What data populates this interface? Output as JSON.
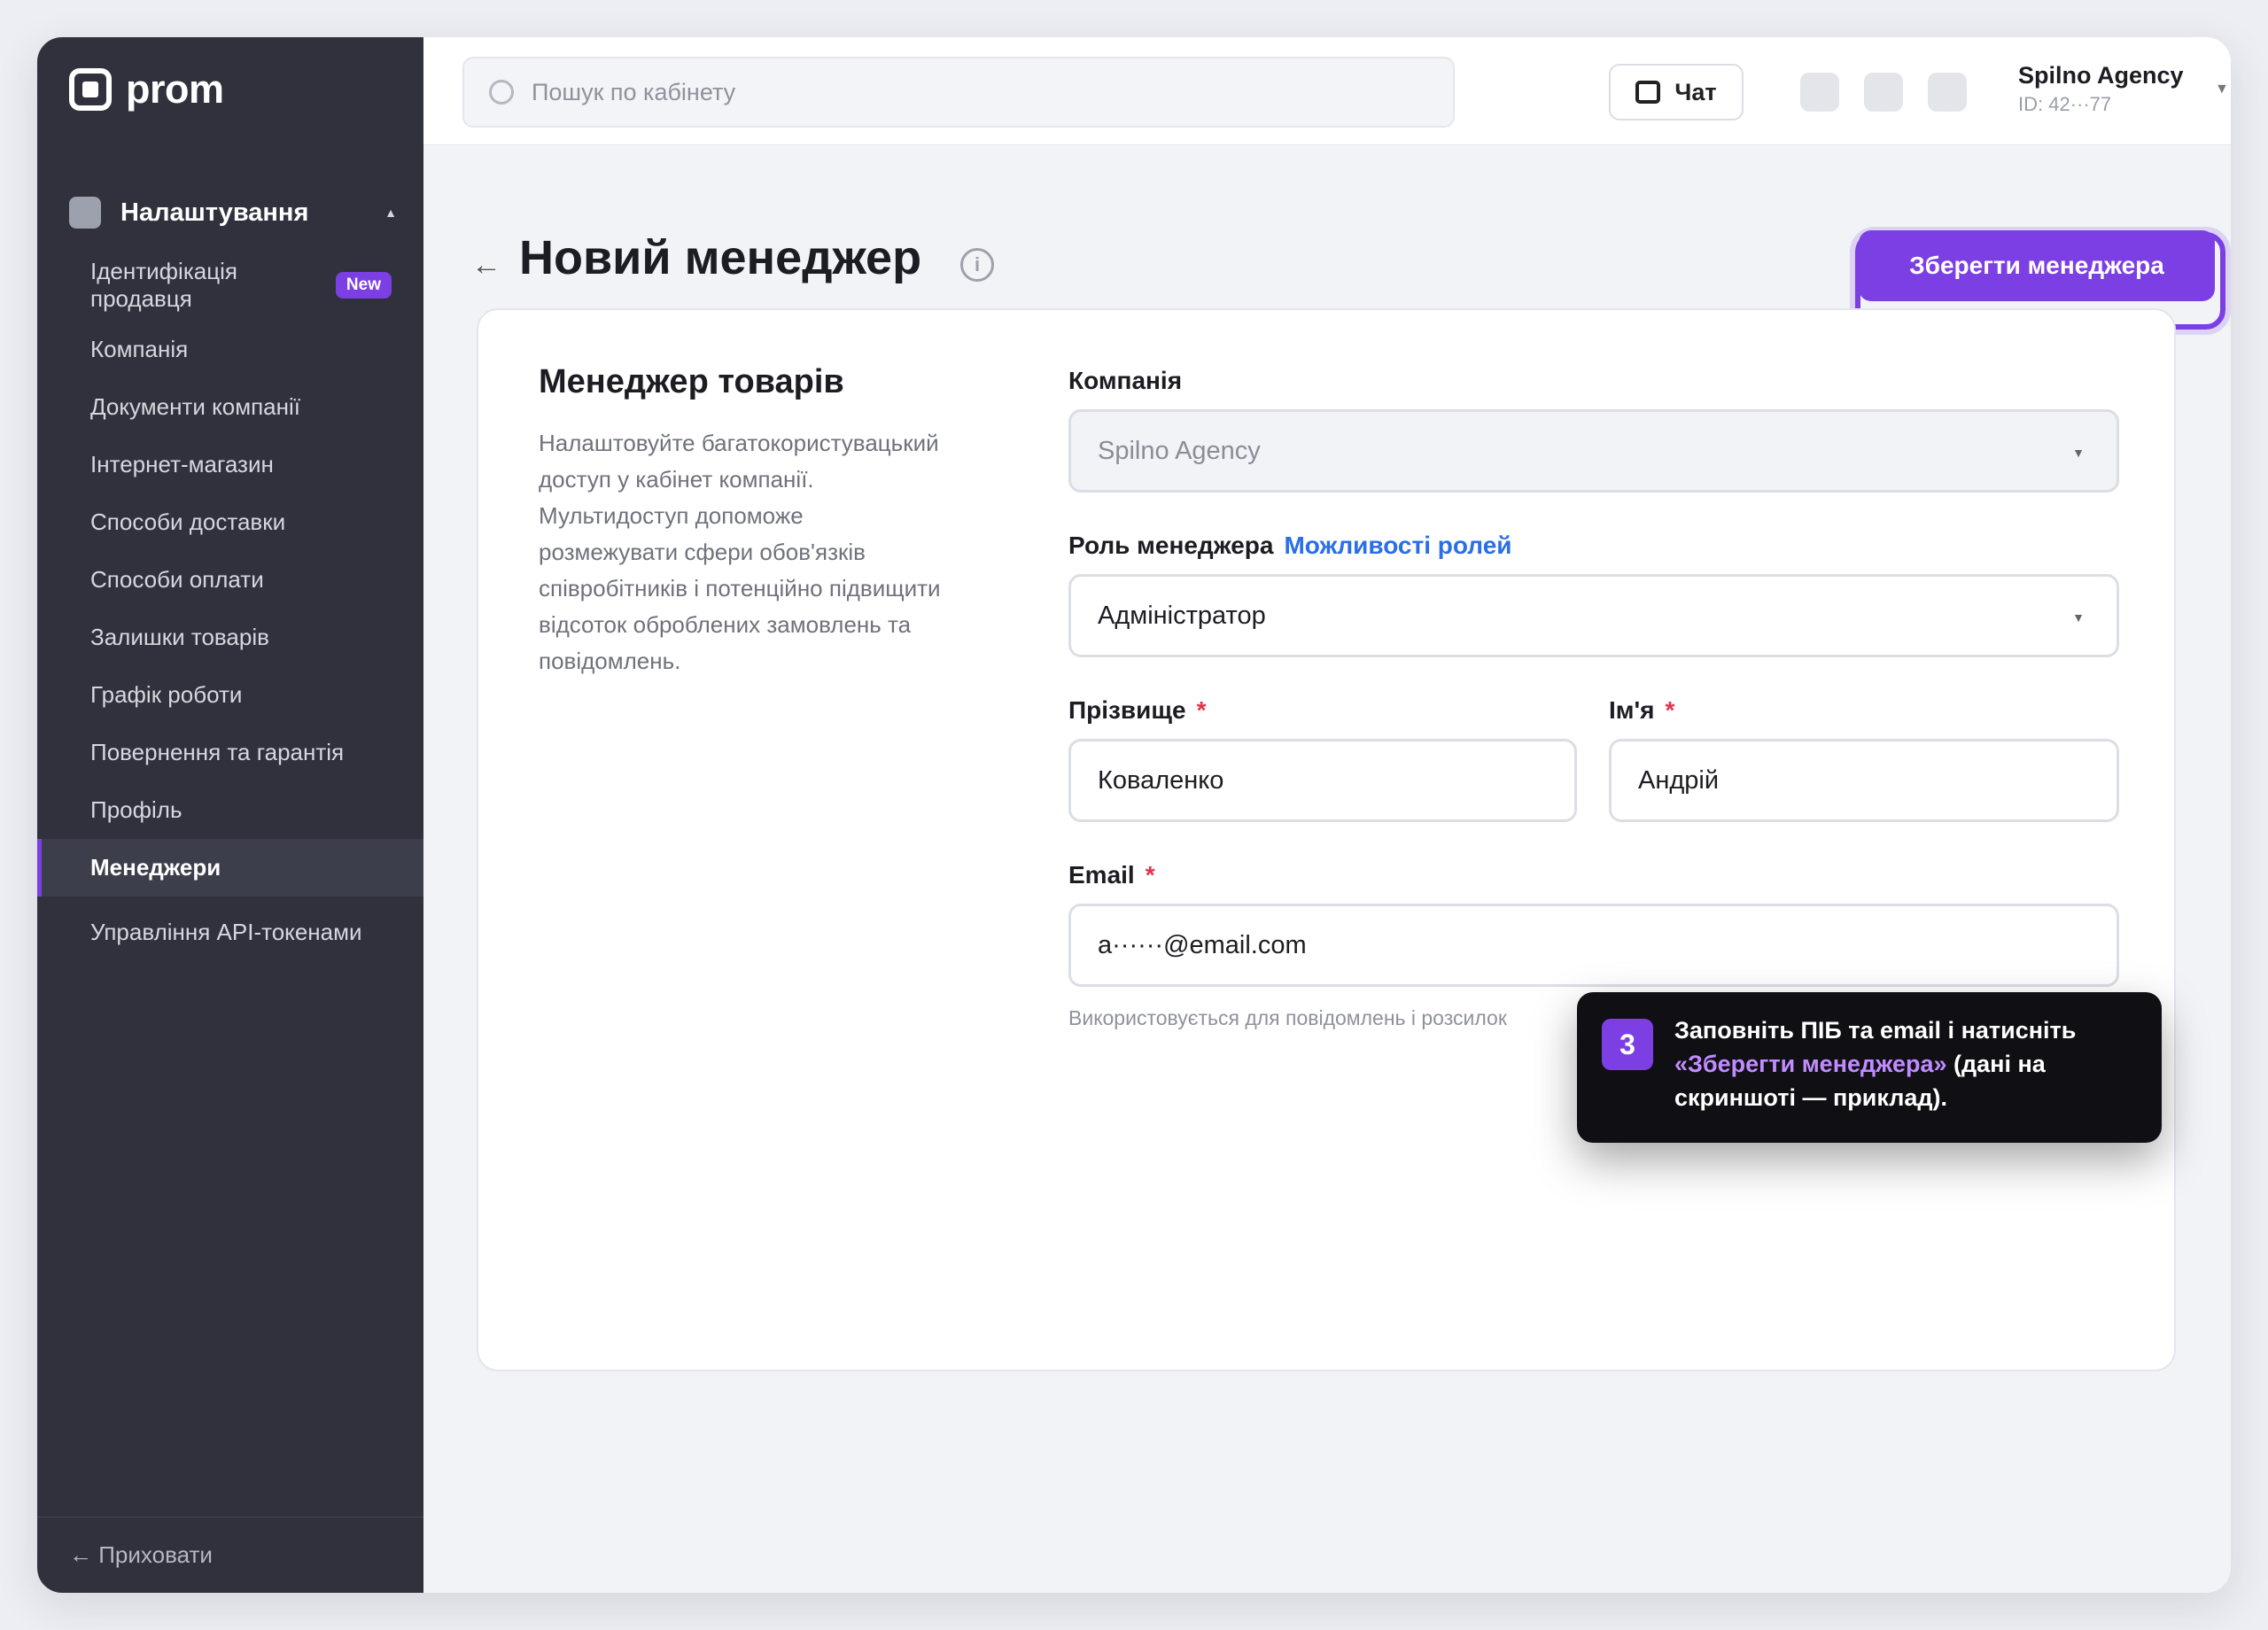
{
  "brand": {
    "name": "prom"
  },
  "sidebar": {
    "section_title": "Налаштування",
    "items": [
      {
        "label": "Ідентифікація продавця",
        "badge": "New"
      },
      {
        "label": "Компанія"
      },
      {
        "label": "Документи компанії"
      },
      {
        "label": "Інтернет-магазин"
      },
      {
        "label": "Способи доставки"
      },
      {
        "label": "Способи оплати"
      },
      {
        "label": "Залишки товарів"
      },
      {
        "label": "Графік роботи"
      },
      {
        "label": "Повернення та гарантія"
      },
      {
        "label": "Профіль"
      },
      {
        "label": "Менеджери",
        "active": true
      },
      {
        "label": "Управління API-токенами"
      }
    ],
    "footer_label": "← Приховати"
  },
  "topbar": {
    "search_placeholder": "Пошук по кабінету",
    "chat_label": "Чат",
    "account_name": "Spilno Agency",
    "account_id": "ID: 42···77"
  },
  "page": {
    "title": "Новий менеджер",
    "save_label": "Зберегти менеджера"
  },
  "card": {
    "title": "Менеджер товарів",
    "description": "Налаштовуйте багатокористувацький доступ у кабінет компанії. Мультидоступ допоможе розмежувати сфери обов'язків співробітників і потенційно підвищити відсоток оброблених замовлень та повідомлень."
  },
  "form": {
    "company_label": "Компанія",
    "company_value": "Spilno Agency",
    "role_label": "Роль менеджера",
    "role_link": "Можливості ролей",
    "role_value": "Адміністратор",
    "lastname_label": "Прізвище",
    "lastname_value": "Коваленко",
    "firstname_label": "Ім'я",
    "firstname_value": "Андрій",
    "email_label": "Email",
    "email_value": "a······@email.com",
    "email_hint": "Використовується для повідомлень і розсилок",
    "required_mark": "*"
  },
  "tooltip": {
    "step": "3",
    "text_before": "Заповніть ПІБ та email і натисніть ",
    "text_accent": "«Зберегти менеджера»",
    "text_after": " (дані на скриншоті — приклад)."
  },
  "colors": {
    "accent": "#7b3fe4",
    "sidebar_bg": "#30313c",
    "link": "#2a6ee8",
    "required": "#e2334c"
  }
}
